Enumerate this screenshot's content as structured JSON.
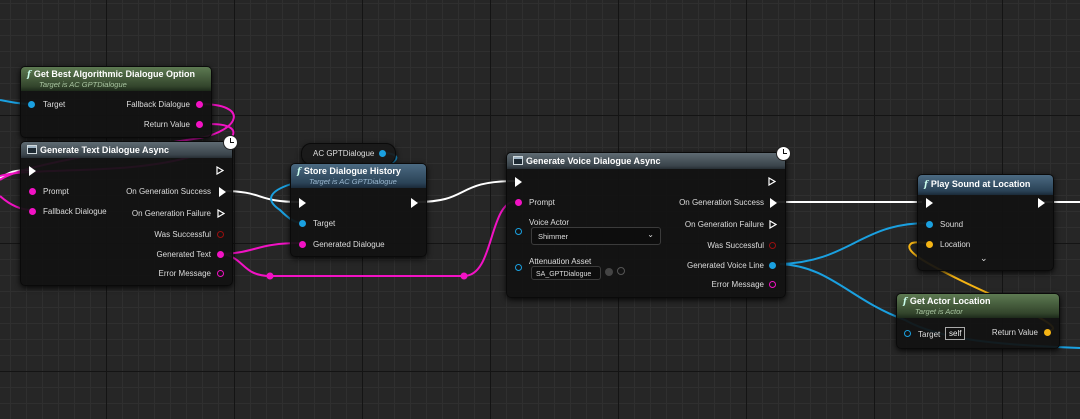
{
  "colors": {
    "string": "#f212c4",
    "object": "#1aa0e0",
    "vector": "#f5b414",
    "exec": "#ffffff",
    "bool_error": "#9b0f0f"
  },
  "nodes": {
    "best_option": {
      "title": "Get Best Algorithmic Dialogue Option",
      "subtitle": "Target is AC GPTDialogue",
      "pins": {
        "target": "Target",
        "fallback": "Fallback Dialogue",
        "return": "Return Value"
      }
    },
    "gen_text": {
      "title": "Generate Text Dialogue Async",
      "pins": {
        "prompt": "Prompt",
        "fallback": "Fallback Dialogue",
        "on_success": "On Generation Success",
        "on_failure": "On Generation Failure",
        "was_successful": "Was Successful",
        "generated_text": "Generated Text",
        "error_message": "Error Message"
      }
    },
    "ac_var": {
      "label": "AC GPTDialogue"
    },
    "store": {
      "title": "Store Dialogue History",
      "subtitle": "Target is AC GPTDialogue",
      "pins": {
        "target": "Target",
        "generated_dialogue": "Generated Dialogue"
      }
    },
    "gen_voice": {
      "title": "Generate Voice Dialogue Async",
      "pins": {
        "prompt": "Prompt",
        "voice_actor": "Voice Actor",
        "voice_actor_value": "Shimmer",
        "attenuation": "Attenuation Asset",
        "attenuation_value": "SA_GPTDialogue",
        "on_success": "On Generation Success",
        "on_failure": "On Generation Failure",
        "was_successful": "Was Successful",
        "generated_voice": "Generated Voice Line",
        "error_message": "Error Message"
      }
    },
    "play_sound": {
      "title": "Play Sound at Location",
      "pins": {
        "sound": "Sound",
        "location": "Location"
      }
    },
    "actor_loc": {
      "title": "Get Actor Location",
      "subtitle": "Target is Actor",
      "pins": {
        "target": "Target",
        "target_value": "self",
        "return": "Return Value"
      }
    }
  }
}
